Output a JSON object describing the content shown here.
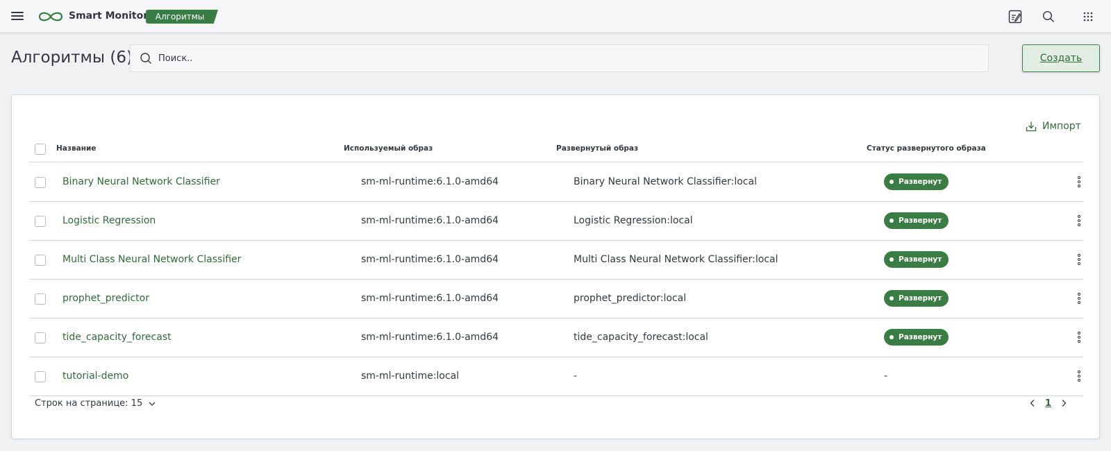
{
  "header": {
    "app_name": "Smart Monitor",
    "breadcrumb": "Алгоритмы",
    "brand_color": "#3a7d44"
  },
  "page": {
    "title": "Алгоритмы (6)",
    "search_placeholder": "Поиск..",
    "create_label": "Создать",
    "import_label": "Импорт"
  },
  "table": {
    "columns": [
      "Название",
      "Используемый образ",
      "Развернутый образ",
      "Статус развернутого образа"
    ],
    "rows": [
      {
        "name": "Binary Neural Network Classifier",
        "image": "sm-ml-runtime:6.1.0-amd64",
        "deployed": "Binary Neural Network Classifier:local",
        "status": "Развернут"
      },
      {
        "name": "Logistic Regression",
        "image": "sm-ml-runtime:6.1.0-amd64",
        "deployed": "Logistic Regression:local",
        "status": "Развернут"
      },
      {
        "name": "Multi Class Neural Network Classifier",
        "image": "sm-ml-runtime:6.1.0-amd64",
        "deployed": "Multi Class Neural Network Classifier:local",
        "status": "Развернут"
      },
      {
        "name": "prophet_predictor",
        "image": "sm-ml-runtime:6.1.0-amd64",
        "deployed": "prophet_predictor:local",
        "status": "Развернут"
      },
      {
        "name": "tide_capacity_forecast",
        "image": "sm-ml-runtime:6.1.0-amd64",
        "deployed": "tide_capacity_forecast:local",
        "status": "Развернут"
      },
      {
        "name": "tutorial-demo",
        "image": "sm-ml-runtime:local",
        "deployed": "-",
        "status": "-"
      }
    ]
  },
  "footer": {
    "rows_per_page": "Строк на странице: 15",
    "current_page": "1"
  },
  "icons": {
    "menu": "hamburger-icon",
    "logo": "infinity-logo-icon",
    "note": "edit-note-icon",
    "search": "search-icon",
    "apps": "apps-grid-icon",
    "import": "import-icon",
    "row_menu": "vertical-dots-icon"
  }
}
